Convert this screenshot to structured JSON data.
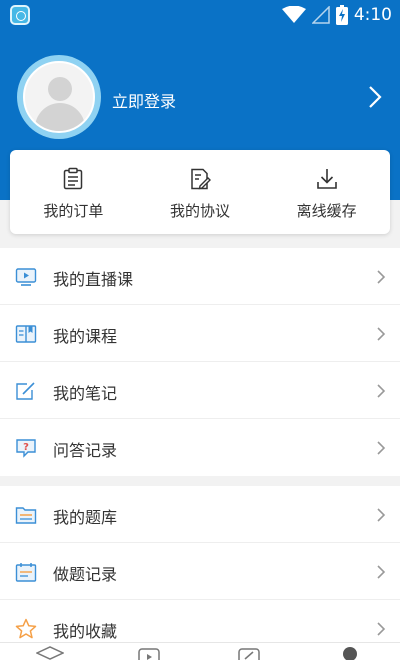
{
  "status_bar": {
    "time": "4:10"
  },
  "header": {
    "login_label": "立即登录"
  },
  "quick_actions": [
    {
      "label": "我的订单",
      "icon": "clipboard-list-icon"
    },
    {
      "label": "我的协议",
      "icon": "document-edit-icon"
    },
    {
      "label": "离线缓存",
      "icon": "download-icon"
    }
  ],
  "menu_group_1": [
    {
      "label": "我的直播课",
      "icon": "live-class-icon"
    },
    {
      "label": "我的课程",
      "icon": "course-book-icon"
    },
    {
      "label": "我的笔记",
      "icon": "note-pen-icon"
    },
    {
      "label": "问答记录",
      "icon": "question-bubble-icon"
    }
  ],
  "menu_group_2": [
    {
      "label": "我的题库",
      "icon": "question-bank-icon"
    },
    {
      "label": "做题记录",
      "icon": "calendar-record-icon"
    },
    {
      "label": "我的收藏",
      "icon": "star-icon"
    }
  ],
  "bottom_nav": [
    "graduation-cap-icon",
    "play-square-icon",
    "edit-square-icon",
    "profile-dot-icon"
  ],
  "colors": {
    "header_blue": "#0a72c6",
    "icon_blue": "#3b8fd6",
    "star_orange": "#f5a047",
    "background": "#f2f2f2"
  }
}
